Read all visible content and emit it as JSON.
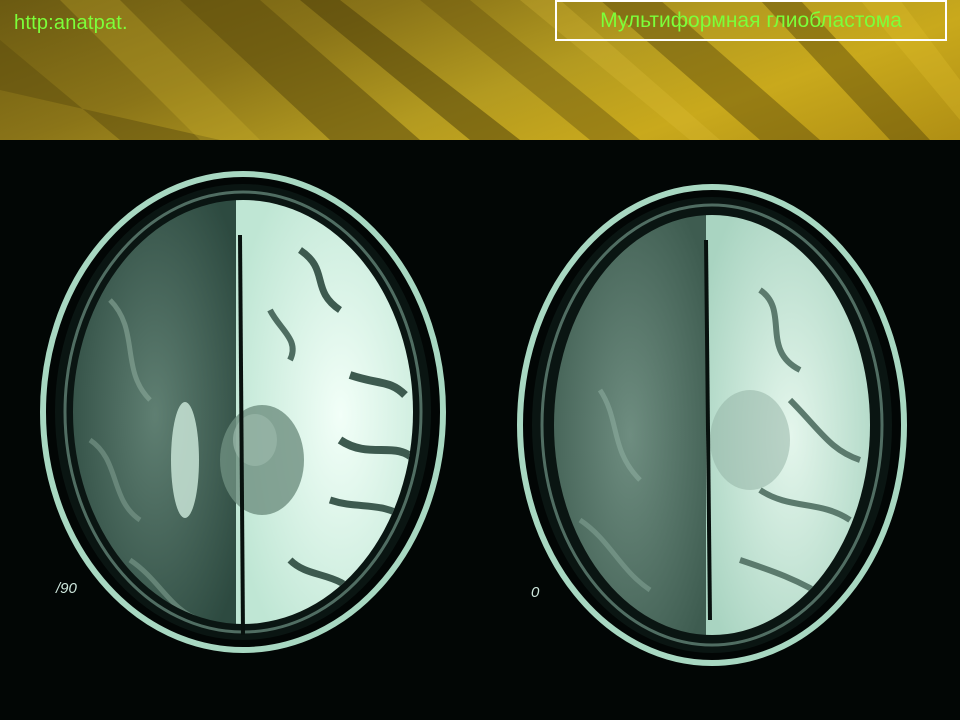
{
  "header": {
    "site_link": "http:anatpat.",
    "title": "Мультиформная глиобластома",
    "accent_color": "#7cff3a"
  },
  "scans": {
    "left_label": "/90",
    "right_label": "0"
  }
}
